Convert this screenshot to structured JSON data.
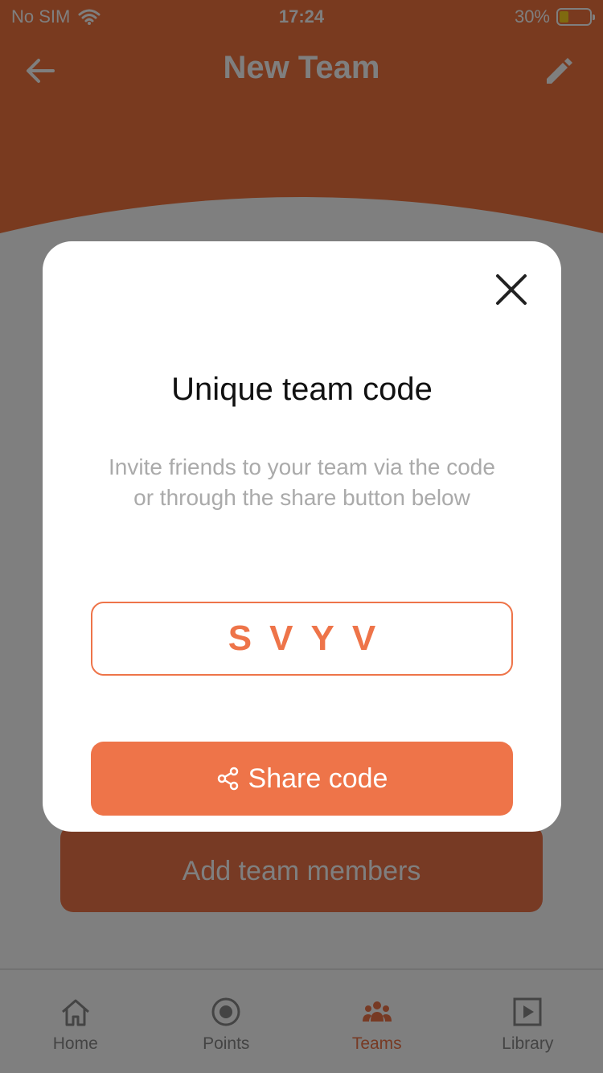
{
  "status_bar": {
    "carrier": "No SIM",
    "time": "17:24",
    "battery_percent": "30%",
    "battery_level": 0.3,
    "icons": [
      "wifi-icon",
      "battery-icon"
    ]
  },
  "header": {
    "title": "New Team",
    "back_icon": "arrow-left-icon",
    "edit_icon": "pencil-icon"
  },
  "page": {
    "add_members_label": "Add team members"
  },
  "modal": {
    "title": "Unique team code",
    "description": "Invite friends to your team via the code or through the share button below",
    "code": "SVYV",
    "share_label": "Share code",
    "close_icon": "close-icon",
    "share_icon": "share-icon"
  },
  "tab_bar": {
    "items": [
      {
        "label": "Home",
        "icon": "home-icon",
        "active": false
      },
      {
        "label": "Points",
        "icon": "target-icon",
        "active": false
      },
      {
        "label": "Teams",
        "icon": "team-icon",
        "active": true
      },
      {
        "label": "Library",
        "icon": "video-library-icon",
        "active": false
      }
    ]
  },
  "colors": {
    "accent": "#ee7449",
    "header": "#f3743f",
    "overlay": "rgba(0,0,0,0.5)",
    "inactive_tab": "#888888",
    "battery_fill": "#ffd21f"
  }
}
